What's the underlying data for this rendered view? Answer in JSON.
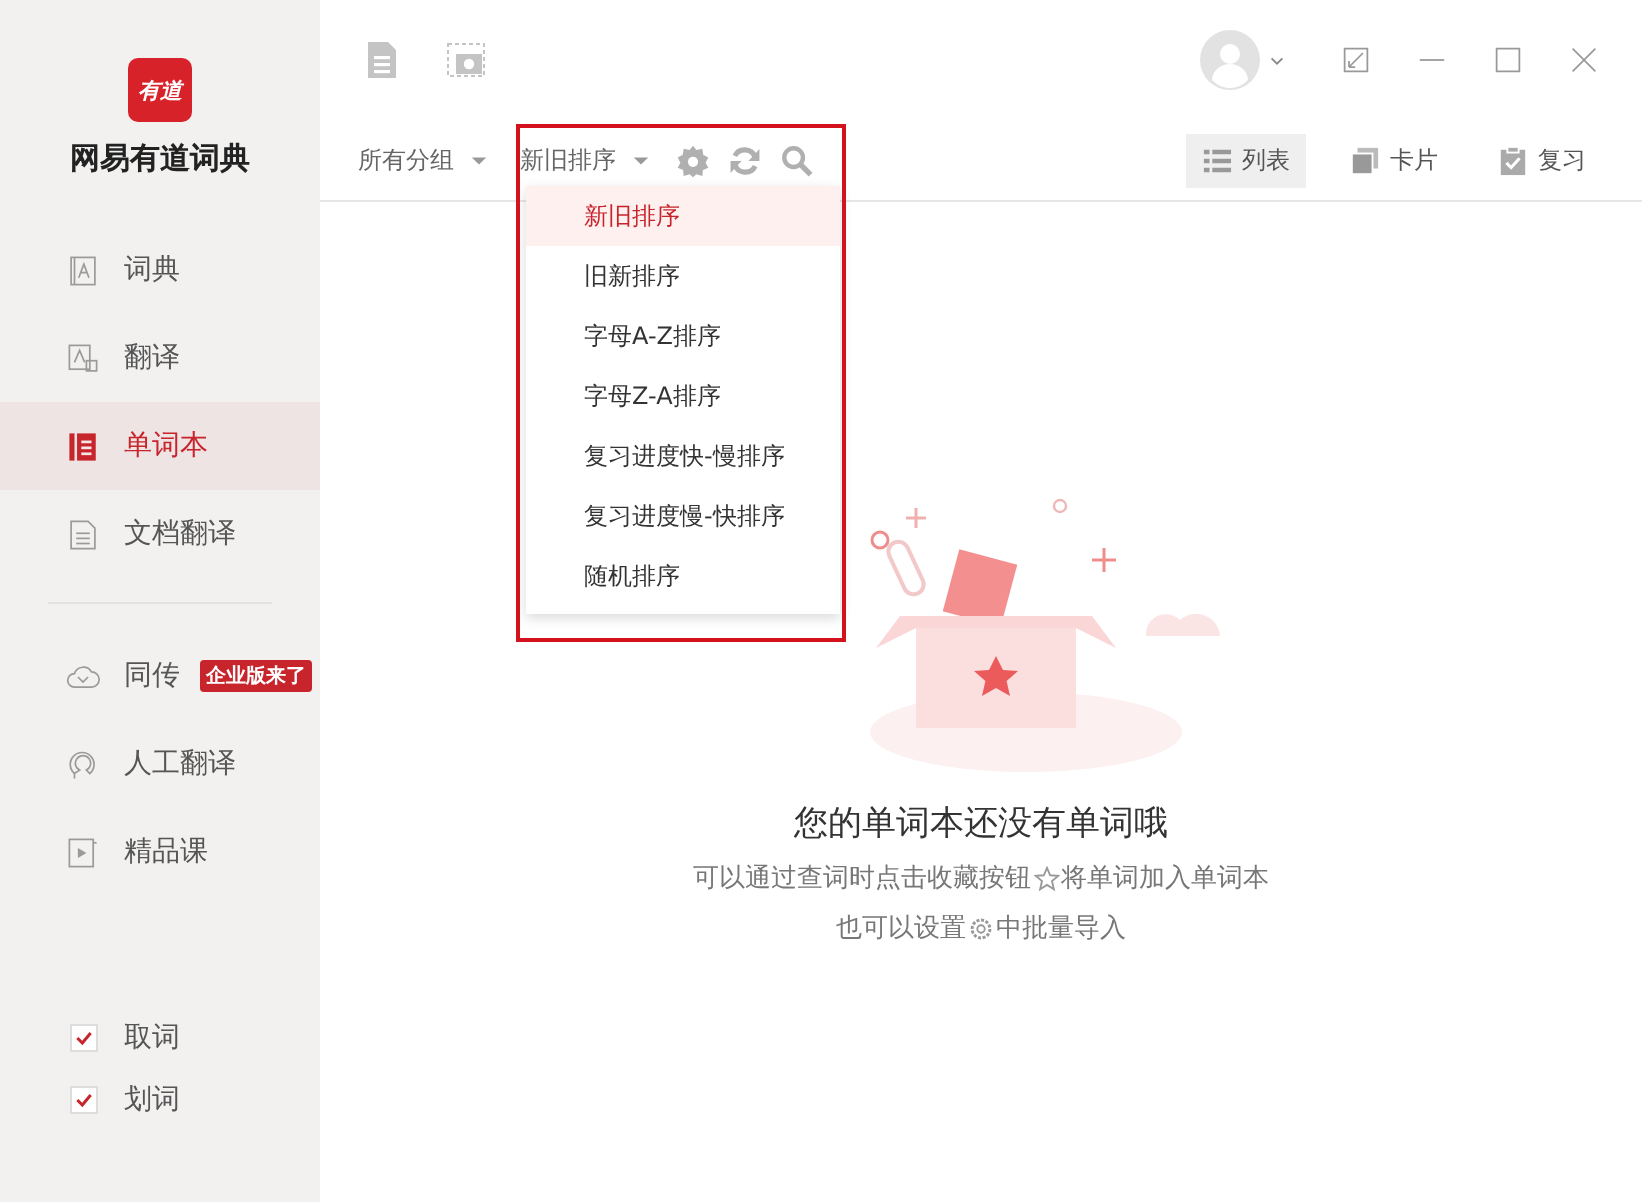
{
  "app": {
    "logo_text": "有道",
    "name": "网易有道词典"
  },
  "sidebar": {
    "groups": [
      [
        {
          "label": "词典",
          "selected": false
        },
        {
          "label": "翻译",
          "selected": false
        },
        {
          "label": "单词本",
          "selected": true
        },
        {
          "label": "文档翻译",
          "selected": false
        }
      ],
      [
        {
          "label": "同传",
          "selected": false,
          "badge": "企业版来了"
        },
        {
          "label": "人工翻译",
          "selected": false
        },
        {
          "label": "精品课",
          "selected": false
        }
      ]
    ],
    "options": [
      {
        "label": "取词",
        "checked": true
      },
      {
        "label": "划词",
        "checked": true
      }
    ]
  },
  "toolbar": {
    "group_filter": "所有分组",
    "sort": "新旧排序",
    "views": [
      {
        "label": "列表",
        "selected": true
      },
      {
        "label": "卡片",
        "selected": false
      },
      {
        "label": "复习",
        "selected": false
      }
    ]
  },
  "sort_menu": {
    "items": [
      {
        "label": "新旧排序",
        "selected": true
      },
      {
        "label": "旧新排序",
        "selected": false
      },
      {
        "label": "字母A-Z排序",
        "selected": false
      },
      {
        "label": "字母Z-A排序",
        "selected": false
      },
      {
        "label": "复习进度快-慢排序",
        "selected": false
      },
      {
        "label": "复习进度慢-快排序",
        "selected": false
      },
      {
        "label": "随机排序",
        "selected": false
      }
    ]
  },
  "empty_state": {
    "title": "您的单词本还没有单词哦",
    "hints": [
      {
        "before": "可以通过查词时点击收藏按钮",
        "kind": "star",
        "after": "将单词加入单词本"
      },
      {
        "before": "也可以设置",
        "kind": "gear",
        "after": "中批量导入"
      }
    ]
  }
}
